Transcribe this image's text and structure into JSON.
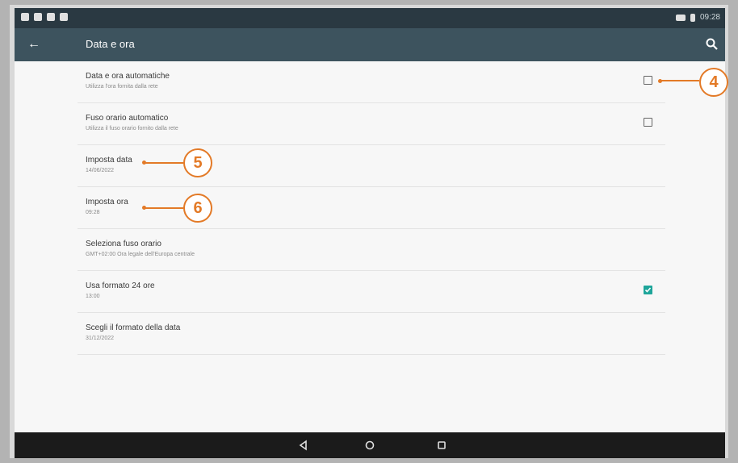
{
  "status_bar": {
    "time": "09:28"
  },
  "app_bar": {
    "title": "Data e ora"
  },
  "settings": [
    {
      "title": "Data e ora automatiche",
      "subtitle": "Utilizza l'ora fornita dalla rete",
      "checkbox": false
    },
    {
      "title": "Fuso orario automatico",
      "subtitle": "Utilizza il fuso orario fornito dalla rete",
      "checkbox": false
    },
    {
      "title": "Imposta data",
      "subtitle": "14/06/2022"
    },
    {
      "title": "Imposta ora",
      "subtitle": "09:28"
    },
    {
      "title": "Seleziona fuso orario",
      "subtitle": "GMT+02:00 Ora legale dell'Europa centrale"
    },
    {
      "title": "Usa formato 24 ore",
      "subtitle": "13:00",
      "checkbox": true
    },
    {
      "title": "Scegli il formato della data",
      "subtitle": "31/12/2022"
    }
  ],
  "callouts": [
    "4",
    "5",
    "6"
  ],
  "colors": {
    "accent": "#1ea59a",
    "callout": "#e37a27",
    "app_bar": "#3d535e",
    "status_bar": "#2a3942"
  }
}
